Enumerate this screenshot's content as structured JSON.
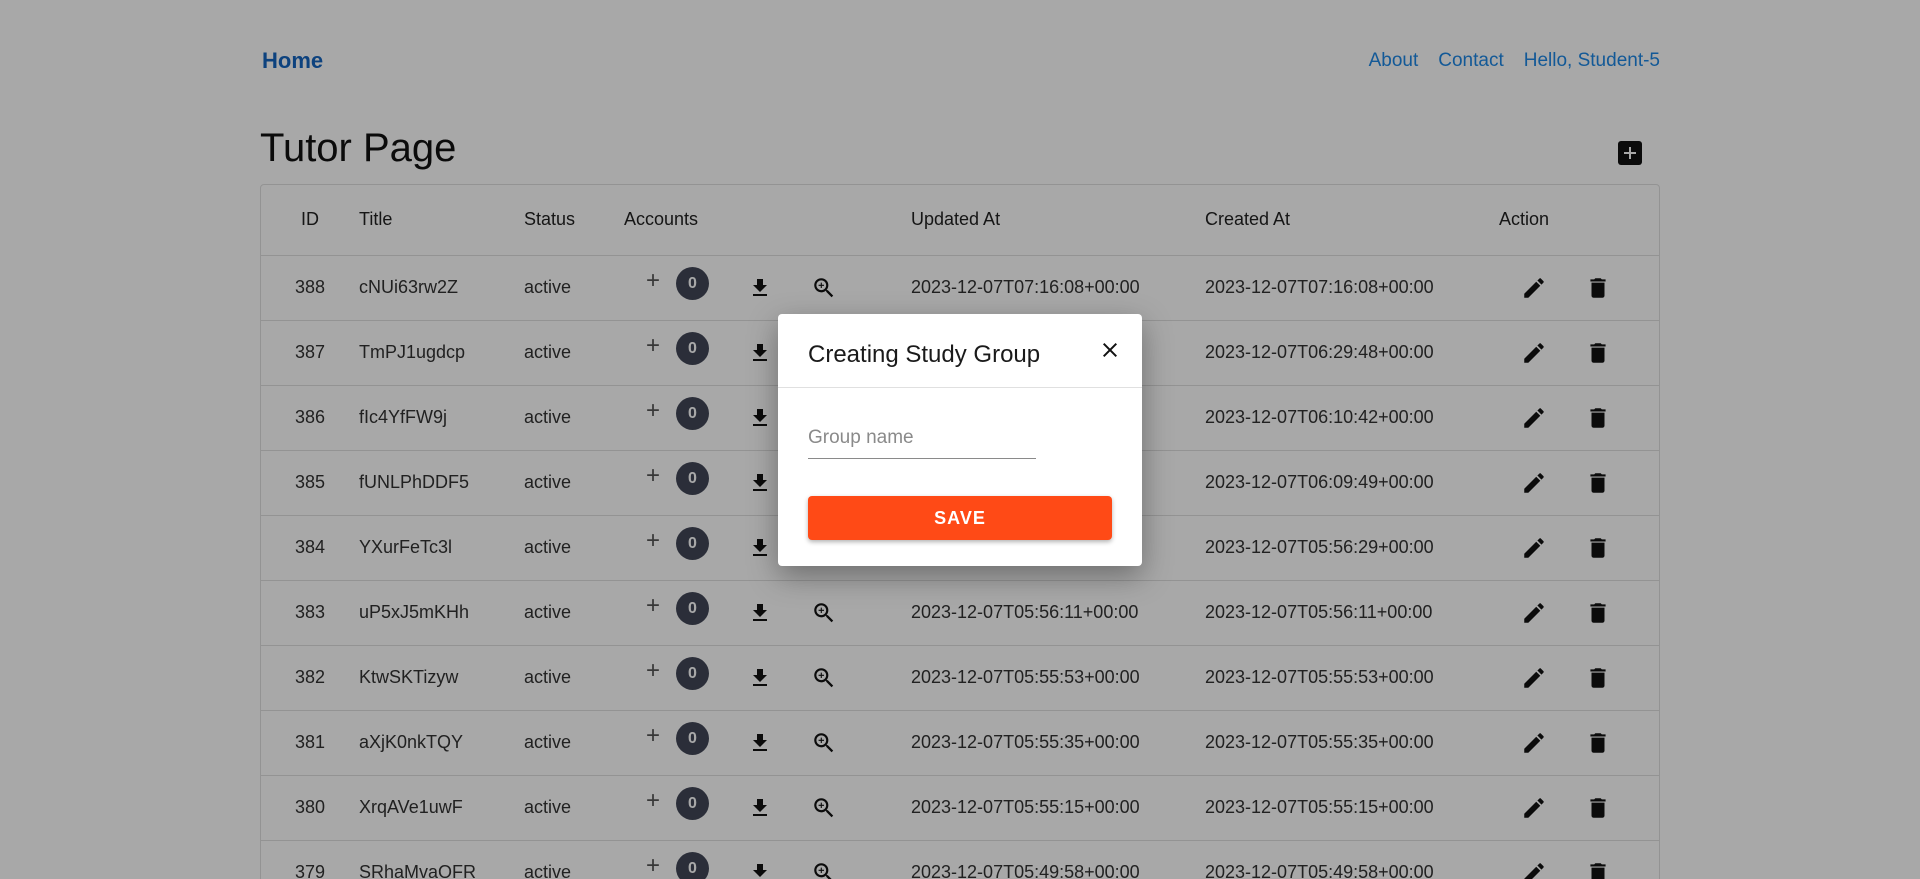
{
  "nav": {
    "home": "Home",
    "links": [
      "About",
      "Contact",
      "Hello, Student-5"
    ]
  },
  "page": {
    "title": "Tutor Page"
  },
  "table": {
    "headers": [
      "ID",
      "Title",
      "Status",
      "Accounts",
      "Updated At",
      "Created At",
      "Action"
    ],
    "rows": [
      {
        "id": "388",
        "title": "cNUi63rw2Z",
        "status": "active",
        "count": "0",
        "updated": "2023-12-07T07:16:08+00:00",
        "created": "2023-12-07T07:16:08+00:00"
      },
      {
        "id": "387",
        "title": "TmPJ1ugdcp",
        "status": "active",
        "count": "0",
        "updated": "",
        "created": "2023-12-07T06:29:48+00:00"
      },
      {
        "id": "386",
        "title": "fIc4YfFW9j",
        "status": "active",
        "count": "0",
        "updated": "",
        "created": "2023-12-07T06:10:42+00:00"
      },
      {
        "id": "385",
        "title": "fUNLPhDDF5",
        "status": "active",
        "count": "0",
        "updated": "",
        "created": "2023-12-07T06:09:49+00:00"
      },
      {
        "id": "384",
        "title": "YXurFeTc3l",
        "status": "active",
        "count": "0",
        "updated": "",
        "created": "2023-12-07T05:56:29+00:00"
      },
      {
        "id": "383",
        "title": "uP5xJ5mKHh",
        "status": "active",
        "count": "0",
        "updated": "2023-12-07T05:56:11+00:00",
        "created": "2023-12-07T05:56:11+00:00"
      },
      {
        "id": "382",
        "title": "KtwSKTizyw",
        "status": "active",
        "count": "0",
        "updated": "2023-12-07T05:55:53+00:00",
        "created": "2023-12-07T05:55:53+00:00"
      },
      {
        "id": "381",
        "title": "aXjK0nkTQY",
        "status": "active",
        "count": "0",
        "updated": "2023-12-07T05:55:35+00:00",
        "created": "2023-12-07T05:55:35+00:00"
      },
      {
        "id": "380",
        "title": "XrqAVe1uwF",
        "status": "active",
        "count": "0",
        "updated": "2023-12-07T05:55:15+00:00",
        "created": "2023-12-07T05:55:15+00:00"
      },
      {
        "id": "379",
        "title": "SRhaMvaOFR",
        "status": "active",
        "count": "0",
        "updated": "2023-12-07T05:49:58+00:00",
        "created": "2023-12-07T05:49:58+00:00"
      }
    ]
  },
  "modal": {
    "title": "Creating Study Group",
    "input_placeholder": "Group name",
    "input_value": "",
    "save_label": "SAVE"
  },
  "colors": {
    "link": "#1e88e5",
    "badge": "#424757",
    "save": "#ff4a16"
  },
  "icons": [
    "plus-icon",
    "download-icon",
    "zoom-in-icon",
    "edit-icon",
    "delete-icon",
    "close-icon",
    "add-box-icon"
  ]
}
